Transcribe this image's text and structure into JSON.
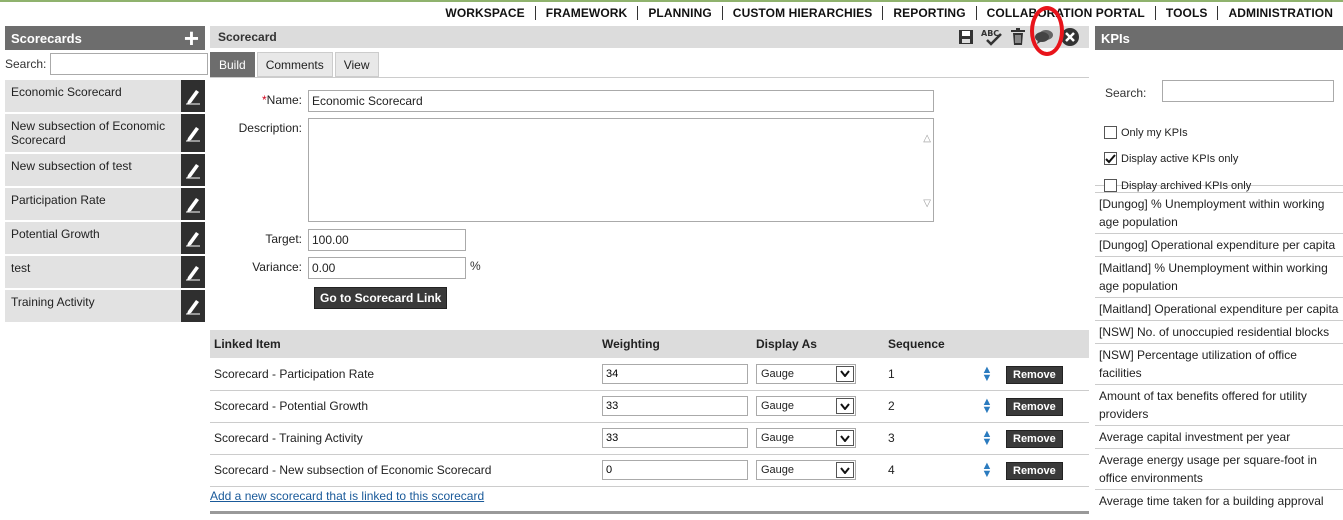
{
  "topnav": [
    "WORKSPACE",
    "FRAMEWORK",
    "PLANNING",
    "CUSTOM HIERARCHIES",
    "REPORTING",
    "COLLABORATION PORTAL",
    "TOOLS",
    "ADMINISTRATION"
  ],
  "left": {
    "title": "Scorecards",
    "search_label": "Search:",
    "items": [
      "Economic Scorecard",
      "New subsection of Economic Scorecard",
      "New subsection of test",
      "Participation Rate",
      "Potential Growth",
      "test",
      "Training Activity"
    ]
  },
  "center": {
    "title": "Scorecard",
    "tabs": [
      "Build",
      "Comments",
      "View"
    ],
    "name_label": "Name:",
    "required_mark": "*",
    "name_value": "Economic Scorecard",
    "description_label": "Description:",
    "target_label": "Target:",
    "target_value": "100.00",
    "variance_label": "Variance:",
    "variance_value": "0.00",
    "variance_unit": "%",
    "goto_button": "Go to Scorecard Link",
    "table": {
      "headers": [
        "Linked Item",
        "Weighting",
        "Display As",
        "Sequence"
      ],
      "rows": [
        {
          "item": "Scorecard - Participation Rate",
          "weighting": "34",
          "display": "Gauge",
          "sequence": "1"
        },
        {
          "item": "Scorecard - Potential Growth",
          "weighting": "33",
          "display": "Gauge",
          "sequence": "2"
        },
        {
          "item": "Scorecard - Training Activity",
          "weighting": "33",
          "display": "Gauge",
          "sequence": "3"
        },
        {
          "item": "Scorecard - New subsection of Economic Scorecard",
          "weighting": "0",
          "display": "Gauge",
          "sequence": "4"
        }
      ],
      "remove_label": "Remove"
    },
    "add_link": "Add a new scorecard that is linked to this scorecard"
  },
  "right": {
    "title": "KPIs",
    "search_label": "Search:",
    "only_mine": "Only my KPIs",
    "active_only": "Display active KPIs only",
    "archived_only": "Display archived KPIs only",
    "kpis": [
      "[Dungog] % Unemployment within working age population",
      "[Dungog] Operational expenditure per capita",
      "[Maitland] % Unemployment within working age population",
      "[Maitland] Operational expenditure per capita",
      "[NSW] No. of unoccupied residential blocks",
      "[NSW] Percentage utilization of office facilities",
      "Amount of tax benefits offered for utility providers",
      "Average capital investment per year",
      "Average energy usage per square-foot in office environments",
      "Average time taken for a building approval"
    ]
  },
  "colors": {
    "highlight": "#e8141b",
    "header": "#6d6d6d",
    "accent_green": "#8fb26d"
  }
}
